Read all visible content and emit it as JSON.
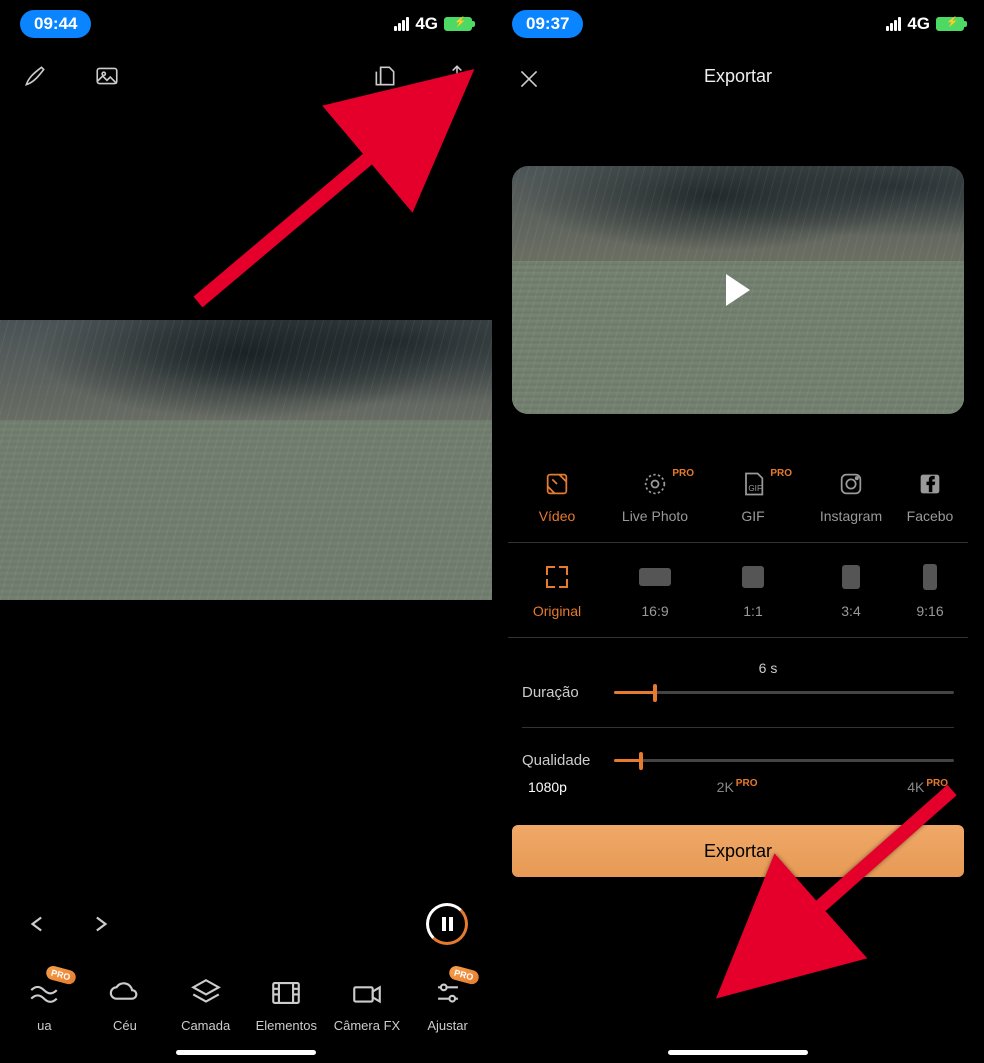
{
  "left": {
    "status": {
      "time": "09:44",
      "network": "4G"
    },
    "controls": {},
    "tools": [
      {
        "label": "ua",
        "icon": "waves",
        "pro": true
      },
      {
        "label": "Céu",
        "icon": "cloud"
      },
      {
        "label": "Camada",
        "icon": "layers"
      },
      {
        "label": "Elementos",
        "icon": "film"
      },
      {
        "label": "Câmera FX",
        "icon": "camera"
      },
      {
        "label": "Ajustar",
        "icon": "sliders",
        "pro": true
      }
    ]
  },
  "right": {
    "status": {
      "time": "09:37",
      "network": "4G"
    },
    "title": "Exportar",
    "formats": [
      {
        "label": "Vídeo",
        "icon": "video",
        "active": true
      },
      {
        "label": "Live Photo",
        "icon": "livephoto",
        "pro": true
      },
      {
        "label": "GIF",
        "icon": "gif",
        "pro": true
      },
      {
        "label": "Instagram",
        "icon": "instagram"
      },
      {
        "label": "Facebo",
        "icon": "facebook"
      }
    ],
    "ratios": [
      {
        "label": "Original",
        "active": true
      },
      {
        "label": "16:9"
      },
      {
        "label": "1:1"
      },
      {
        "label": "3:4"
      },
      {
        "label": "9:16"
      }
    ],
    "duration": {
      "label": "Duração",
      "value_text": "6 s",
      "percent": 12
    },
    "quality": {
      "label": "Qualidade",
      "percent": 8,
      "options": [
        {
          "label": "1080p",
          "active": true
        },
        {
          "label": "2K",
          "pro": true
        },
        {
          "label": "4K",
          "pro": true
        }
      ]
    },
    "export_button": "Exportar"
  }
}
